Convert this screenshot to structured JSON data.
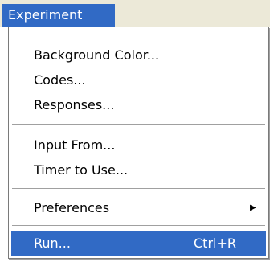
{
  "menubar": {
    "title": "Experiment"
  },
  "menu": {
    "items": [
      {
        "label": "Background Color..."
      },
      {
        "label": "Codes..."
      },
      {
        "label": "Responses..."
      },
      {
        "label": "Input From..."
      },
      {
        "label": "Timer to Use..."
      },
      {
        "label": "Preferences",
        "submenu_icon": "submenu-arrow-icon",
        "arrow": "▶"
      },
      {
        "label": "Run...",
        "shortcut": "Ctrl+R",
        "selected": true
      }
    ]
  },
  "colors": {
    "highlight": "#316ac5",
    "menubar_bg": "#ece9d8",
    "menu_bg": "#ffffff",
    "separator": "#a0a0a0"
  }
}
